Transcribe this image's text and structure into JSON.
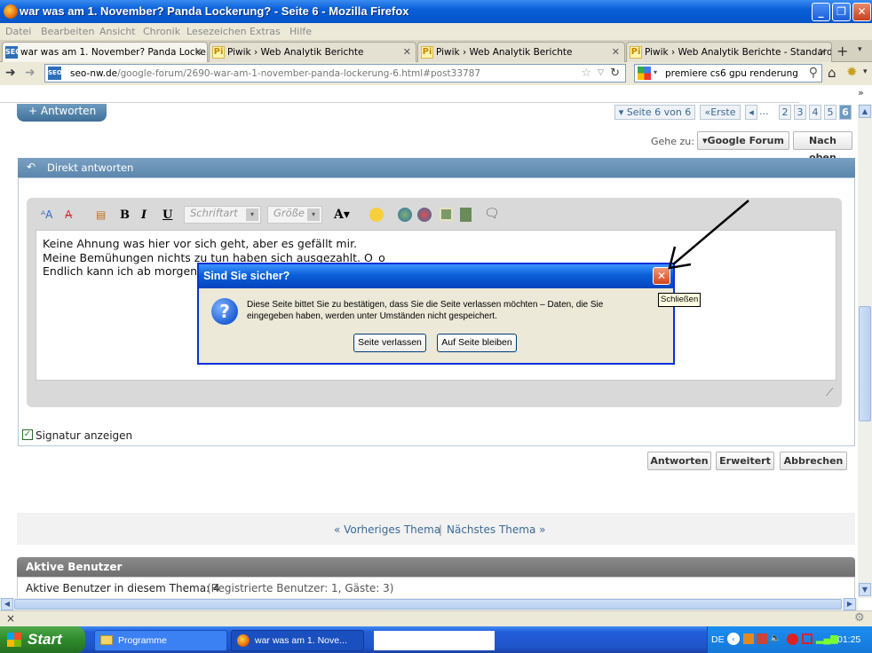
{
  "window": {
    "title": "war was am 1. November? Panda Lockerung? - Seite 6 - Mozilla Firefox"
  },
  "menu": [
    "Datei",
    "Bearbeiten",
    "Ansicht",
    "Chronik",
    "Lesezeichen",
    "Extras",
    "Hilfe"
  ],
  "tabs": [
    {
      "label": "war was am 1. November? Panda Locke...",
      "icon": "seo-favicon"
    },
    {
      "label": "Piwik › Web Analytik Berichte",
      "icon": "piwik-favicon"
    },
    {
      "label": "Piwik › Web Analytik Berichte",
      "icon": "piwik-favicon"
    },
    {
      "label": "Piwik › Web Analytik Berichte - Standard...",
      "icon": "piwik-favicon"
    }
  ],
  "nav": {
    "url_domain": "seo-nw.de",
    "url_path": "/google-forum/2690-war-am-1-november-panda-lockerung-6.html#post33787",
    "search_query": "premiere cs6 gpu renderung"
  },
  "page": {
    "reply_button": "+ Antworten",
    "pagination": {
      "label": "▾ Seite 6 von 6",
      "first": "«Erste",
      "prev": "◂",
      "ellipsis": "...",
      "pages": [
        "2",
        "3",
        "4",
        "5",
        "6"
      ],
      "current": "6"
    },
    "goto_label": "Gehe zu:",
    "goto_forum": "▾Google Forum",
    "to_top": "Nach oben",
    "quick_reply_title": "Direkt antworten",
    "editor": {
      "font_select": "Schriftart",
      "size_select": "Größe",
      "lines": [
        "Keine Ahnung was hier vor sich geht, aber es gefällt mir.",
        "Meine Bemühungen nichts zu tun haben sich ausgezahlt. O_o",
        "Endlich kann ich ab morgen"
      ]
    },
    "signature_label": "Signatur anzeigen",
    "buttons": {
      "reply": "Antworten",
      "advanced": "Erweitert",
      "cancel": "Abbrechen"
    },
    "thread_nav": {
      "prev": "« Vorheriges Thema",
      "sep": "|",
      "next": "Nächstes Thema »"
    },
    "active_users": {
      "title": "Aktive Benutzer",
      "text": "Aktive Benutzer in diesem Thema: 4",
      "detail": "(Registrierte Benutzer: 1, Gäste: 3)"
    }
  },
  "dialog": {
    "title": "Sind Sie sicher?",
    "message": "Diese Seite bittet Sie zu bestätigen, dass Sie die Seite verlassen möchten – Daten, die Sie eingegeben haben, werden unter Umständen nicht gespeichert.",
    "leave_button": "Seite verlassen",
    "stay_button": "Auf Seite bleiben",
    "close_tooltip": "Schließen"
  },
  "taskbar": {
    "start": "Start",
    "items": [
      "Programme",
      "war was am 1. Nove..."
    ],
    "lang": "DE",
    "clock": "01:25"
  }
}
